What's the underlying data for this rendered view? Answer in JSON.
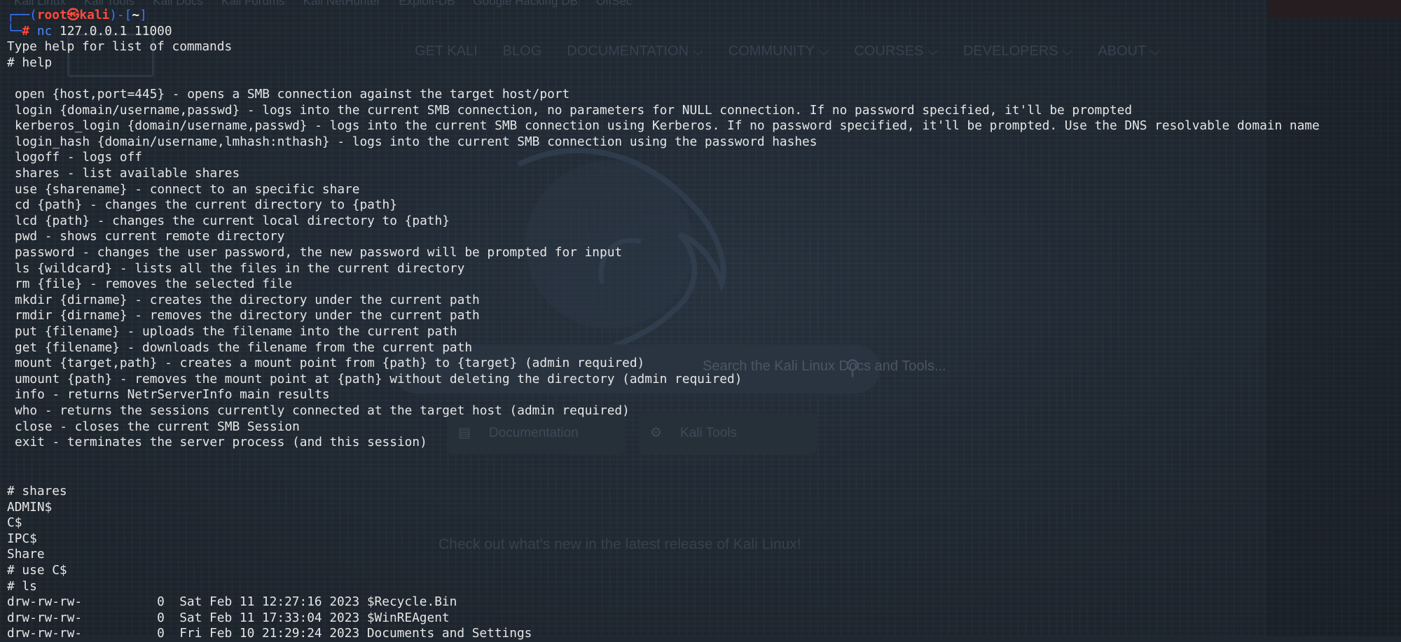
{
  "background": {
    "bookmarks": [
      "Kali Linux",
      "Kali Tools",
      "Kali Docs",
      "Kali Forums",
      "Kali NetHunter",
      "Exploit-DB",
      "Google Hacking DB",
      "OffSec"
    ],
    "nav": [
      "GET KALI",
      "BLOG",
      "DOCUMENTATION ⌵",
      "COMMUNITY ⌵",
      "COURSES ⌵",
      "DEVELOPERS ⌵",
      "ABOUT ⌵"
    ],
    "search_placeholder": "Search the Kali Linux Docs and Tools...",
    "buttons": [
      {
        "icon": "▤",
        "label": "Documentation"
      },
      {
        "icon": "⚙",
        "label": "Kali Tools"
      }
    ],
    "release_text": "Check out what's new in the latest release of Kali Linux!"
  },
  "terminal": {
    "prompt": {
      "frame_top": "┌──(",
      "user": "root㉿kali",
      "mid": ")-[",
      "path": "~",
      "close": "]",
      "frame_bottom": "└─",
      "hash": "#",
      "cmd": "nc",
      "args": " 127.0.0.1 11000"
    },
    "intro": "Type help for list of commands",
    "help_cmd": "# help",
    "help_lines": [
      "open {host,port=445} - opens a SMB connection against the target host/port",
      "login {domain/username,passwd} - logs into the current SMB connection, no parameters for NULL connection. If no password specified, it'll be prompted",
      "kerberos_login {domain/username,passwd} - logs into the current SMB connection using Kerberos. If no password specified, it'll be prompted. Use the DNS resolvable domain name",
      "login_hash {domain/username,lmhash:nthash} - logs into the current SMB connection using the password hashes",
      "logoff - logs off",
      "shares - list available shares",
      "use {sharename} - connect to an specific share",
      "cd {path} - changes the current directory to {path}",
      "lcd {path} - changes the current local directory to {path}",
      "pwd - shows current remote directory",
      "password - changes the user password, the new password will be prompted for input",
      "ls {wildcard} - lists all the files in the current directory",
      "rm {file} - removes the selected file",
      "mkdir {dirname} - creates the directory under the current path",
      "rmdir {dirname} - removes the directory under the current path",
      "put {filename} - uploads the filename into the current path",
      "get {filename} - downloads the filename from the current path",
      "mount {target,path} - creates a mount point from {path} to {target} (admin required)",
      "umount {path} - removes the mount point at {path} without deleting the directory (admin required)",
      "info - returns NetrServerInfo main results",
      "who - returns the sessions currently connected at the target host (admin required)",
      "close - closes the current SMB Session",
      "exit - terminates the server process (and this session)"
    ],
    "shares_cmd": "# shares",
    "shares": [
      "ADMIN$",
      "C$",
      "IPC$",
      "Share"
    ],
    "use_cmd": "# use C$",
    "ls_cmd": "# ls",
    "ls_lines": [
      "drw-rw-rw-          0  Sat Feb 11 12:27:16 2023 $Recycle.Bin",
      "drw-rw-rw-          0  Sat Feb 11 17:33:04 2023 $WinREAgent",
      "drw-rw-rw-          0  Fri Feb 10 21:29:24 2023 Documents and Settings"
    ]
  }
}
